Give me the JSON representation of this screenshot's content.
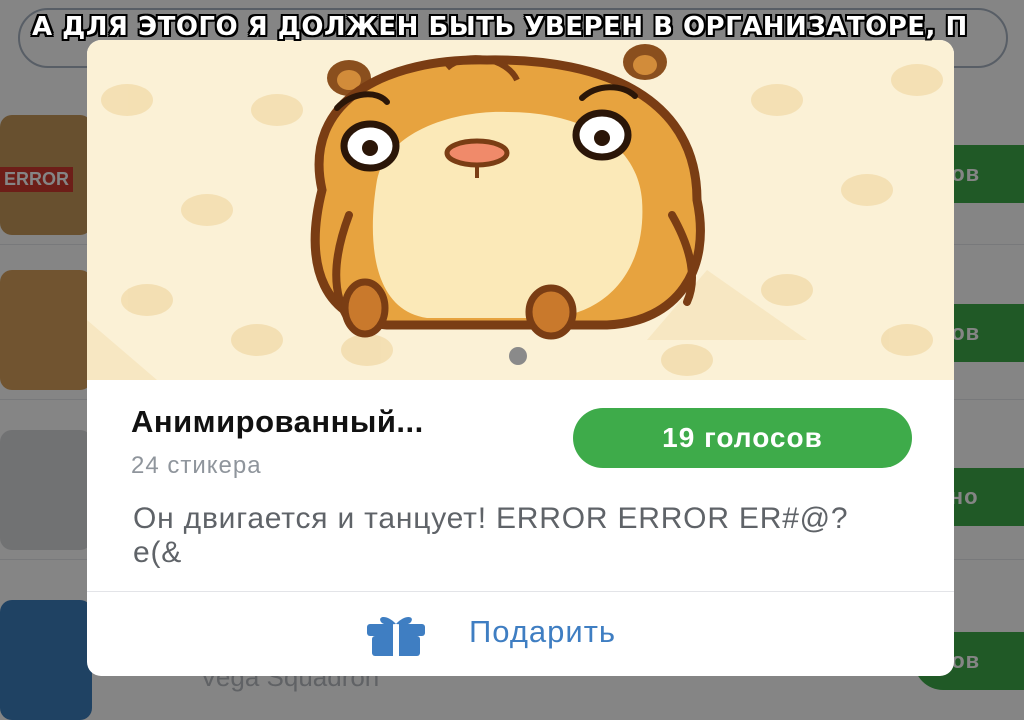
{
  "meme": {
    "caption": "А ДЛЯ ЭТОГО Я ДОЛЖЕН БЫТЬ УВЕРЕН В ОРГАНИЗАТОРЕ, П"
  },
  "background": {
    "error_thumb_text": "ERROR",
    "buttons": [
      "сов",
      "сов",
      "тно",
      "сов"
    ],
    "bottom_item_caption": "Vega Squadron"
  },
  "modal": {
    "title": "Анимированный...",
    "sticker_count": "24 стикера",
    "votes_button": "19 голосов",
    "description": "Он двигается и танцует! ERROR ERROR ER#@?e(&",
    "gift_label": "Подарить",
    "icon": "gift-icon"
  },
  "colors": {
    "accent_green": "#3eab4a",
    "link_blue": "#3f7ec2",
    "hero_bg": "#fbf1d6"
  }
}
